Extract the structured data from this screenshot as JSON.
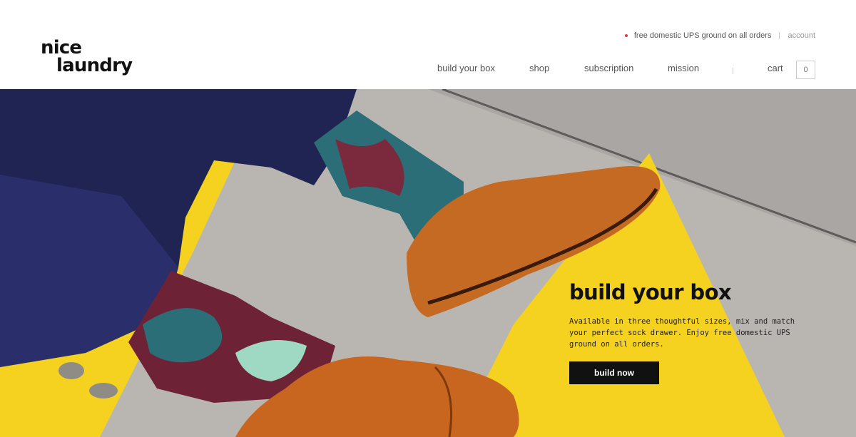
{
  "brand": {
    "logo_line1": "nice",
    "logo_line2": "laundry"
  },
  "topbar": {
    "promo": "free domestic UPS ground on all orders",
    "account": "account"
  },
  "nav": {
    "items": [
      {
        "label": "build your box"
      },
      {
        "label": "shop"
      },
      {
        "label": "subscription"
      },
      {
        "label": "mission"
      }
    ],
    "cart_label": "cart",
    "cart_count": "0"
  },
  "hero": {
    "title": "build your box",
    "description": "Available in three thoughtful sizes, mix and match your perfect sock drawer. Enjoy free domestic UPS ground on all orders.",
    "cta_label": "build now"
  },
  "colors": {
    "accent_dot": "#e0384a",
    "cta_bg": "#111111",
    "hero_yellow": "#f5d21f"
  },
  "icons": {
    "promo_dot": "dot-icon"
  }
}
